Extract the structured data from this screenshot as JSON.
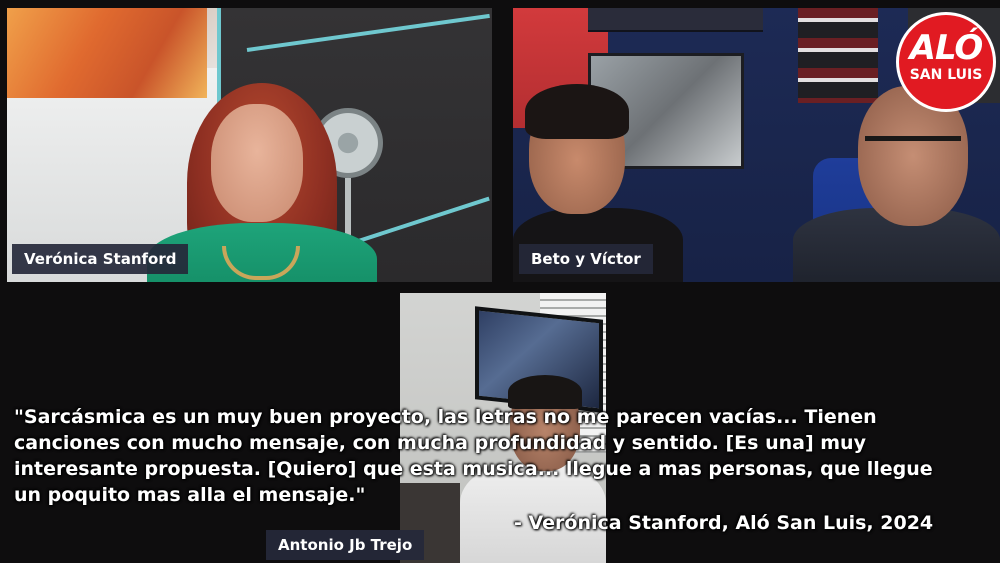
{
  "participants": [
    {
      "name": "Verónica Stanford"
    },
    {
      "name": "Beto y Víctor"
    },
    {
      "name": "Antonio Jb Trejo"
    }
  ],
  "logo": {
    "main": "ALÓ",
    "sub": "SAN LUIS",
    "color": "#e11a22"
  },
  "quote": {
    "lines": [
      "\"Sarcásmica es un muy buen proyecto, las letras no me parecen vacías... Tienen",
      "canciones con mucho mensaje, con mucha profundidad y sentido. [Es una] muy",
      "interesante propuesta. [Quiero] que esta musica... llegue a mas personas, que llegue",
      "un poquito mas alla el mensaje.\""
    ],
    "attribution": "- Verónica Stanford, Aló San Luis, 2024"
  },
  "colors": {
    "background": "#0e0d0e",
    "label_bg": "#25283a",
    "text": "#ffffff"
  }
}
